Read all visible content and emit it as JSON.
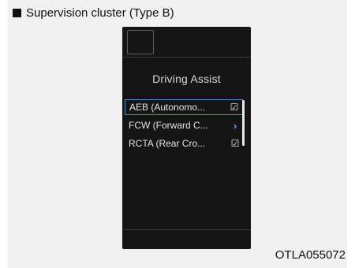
{
  "caption": "Supervision cluster (Type B)",
  "screen": {
    "title": "Driving Assist",
    "items": [
      {
        "label": "AEB (Autonomo...",
        "control": "checkbox",
        "checked": true,
        "selected": true
      },
      {
        "label": "FCW (Forward C...",
        "control": "chevron",
        "icon": "chevron-right-icon"
      },
      {
        "label": "RCTA (Rear Cro...",
        "control": "checkbox",
        "checked": true
      }
    ],
    "check_glyph": "☑",
    "chevron_glyph": "›"
  },
  "figure_code": "OTLA055072"
}
